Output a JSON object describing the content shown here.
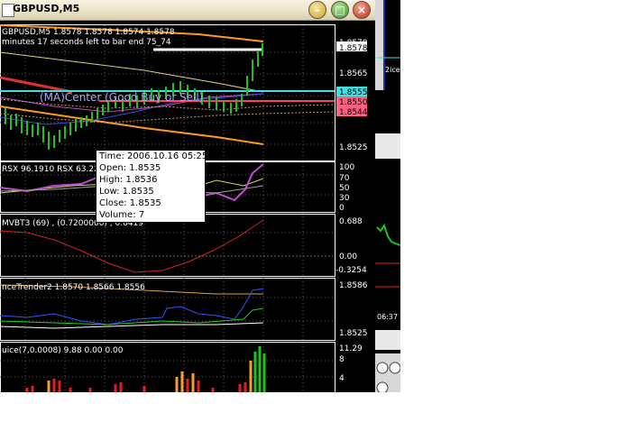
{
  "window": {
    "title": "GBPUSD,M5",
    "buttons": {
      "minimize": "–",
      "maximize": "□",
      "close": "×"
    }
  },
  "main_chart": {
    "header": "GBPUSD,M5  1.8578 1.8578 1.8574 1.8578",
    "countdown": "minutes 17 seconds left to bar end 75_74",
    "center_label": "(MA)Center (Good Buy or Sell)",
    "price_labels": {
      "p1": "1.8578",
      "p2": "1.8578",
      "p3": "1.8565",
      "p4": "1.8555",
      "p5": "1.8550",
      "p6": "1.8544",
      "p7": "1.8525"
    },
    "colors": {
      "bid_line": "#ffffff",
      "center_line": "#40e0e0",
      "sell_line": "#ff6080",
      "buy_level": "#ff4040"
    }
  },
  "tooltip": {
    "time": "Time: 2006.10.16 05:25",
    "open": "Open: 1.8535",
    "high": "High: 1.8536",
    "low": "Low:  1.8535",
    "close": "Close: 1.8535",
    "volume": "Volume: 7"
  },
  "rsx": {
    "header": "RSX 96.1910  RSX 63.2261",
    "scale": {
      "a": "100",
      "b": "70",
      "c": "50",
      "d": "30",
      "e": "0"
    }
  },
  "mvbt": {
    "header": "MVBT3 (69) , (0.7200000) , 0.6419",
    "scale": {
      "a": "0.688",
      "b": "0.00",
      "c": "-0.3254"
    }
  },
  "trender": {
    "header": "nceTrender2 1.8570 1.8566 1.8556",
    "scale": {
      "a": "1.8586",
      "b": "1.8525"
    }
  },
  "juice": {
    "header": "uice(7,0.0008) 9.88 0.00 0.00",
    "scale": {
      "a": "11.29",
      "b": "8",
      "c": "4"
    }
  },
  "right_pane": {
    "price_snippet": "2ice",
    "time_snippet": "06:37"
  }
}
